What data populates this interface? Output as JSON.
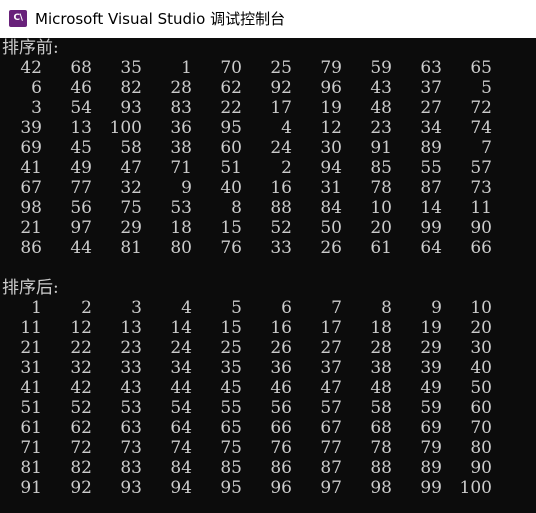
{
  "window": {
    "icon_text": "C\\",
    "title": "Microsoft Visual Studio 调试控制台"
  },
  "console": {
    "before_label": "排序前:",
    "before_rows": [
      [
        "42",
        "68",
        "35",
        "1",
        "70",
        "25",
        "79",
        "59",
        "63",
        "65"
      ],
      [
        "6",
        "46",
        "82",
        "28",
        "62",
        "92",
        "96",
        "43",
        "37",
        "5"
      ],
      [
        "3",
        "54",
        "93",
        "83",
        "22",
        "17",
        "19",
        "48",
        "27",
        "72"
      ],
      [
        "39",
        "13",
        "100",
        "36",
        "95",
        "4",
        "12",
        "23",
        "34",
        "74"
      ],
      [
        "69",
        "45",
        "58",
        "38",
        "60",
        "24",
        "30",
        "91",
        "89",
        "7"
      ],
      [
        "41",
        "49",
        "47",
        "71",
        "51",
        "2",
        "94",
        "85",
        "55",
        "57"
      ],
      [
        "67",
        "77",
        "32",
        "9",
        "40",
        "16",
        "31",
        "78",
        "87",
        "73"
      ],
      [
        "98",
        "56",
        "75",
        "53",
        "8",
        "88",
        "84",
        "10",
        "14",
        "11"
      ],
      [
        "21",
        "97",
        "29",
        "18",
        "15",
        "52",
        "50",
        "20",
        "99",
        "90"
      ],
      [
        "86",
        "44",
        "81",
        "80",
        "76",
        "33",
        "26",
        "61",
        "64",
        "66"
      ]
    ],
    "after_label": "排序后:",
    "after_rows": [
      [
        "1",
        "2",
        "3",
        "4",
        "5",
        "6",
        "7",
        "8",
        "9",
        "10"
      ],
      [
        "11",
        "12",
        "13",
        "14",
        "15",
        "16",
        "17",
        "18",
        "19",
        "20"
      ],
      [
        "21",
        "22",
        "23",
        "24",
        "25",
        "26",
        "27",
        "28",
        "29",
        "30"
      ],
      [
        "31",
        "32",
        "33",
        "34",
        "35",
        "36",
        "37",
        "38",
        "39",
        "40"
      ],
      [
        "41",
        "42",
        "43",
        "44",
        "45",
        "46",
        "47",
        "48",
        "49",
        "50"
      ],
      [
        "51",
        "52",
        "53",
        "54",
        "55",
        "56",
        "57",
        "58",
        "59",
        "60"
      ],
      [
        "61",
        "62",
        "63",
        "64",
        "65",
        "66",
        "67",
        "68",
        "69",
        "70"
      ],
      [
        "71",
        "72",
        "73",
        "74",
        "75",
        "76",
        "77",
        "78",
        "79",
        "80"
      ],
      [
        "81",
        "82",
        "83",
        "84",
        "85",
        "86",
        "87",
        "88",
        "89",
        "90"
      ],
      [
        "91",
        "92",
        "93",
        "94",
        "95",
        "96",
        "97",
        "98",
        "99",
        "100"
      ]
    ]
  },
  "colors": {
    "console_background": "#0c0c0c",
    "console_text": "#cccccc",
    "titlebar_background": "#ffffff",
    "app_icon": "#68217a"
  },
  "icons": {
    "app_icon": "visual-studio-debug-console-icon"
  }
}
